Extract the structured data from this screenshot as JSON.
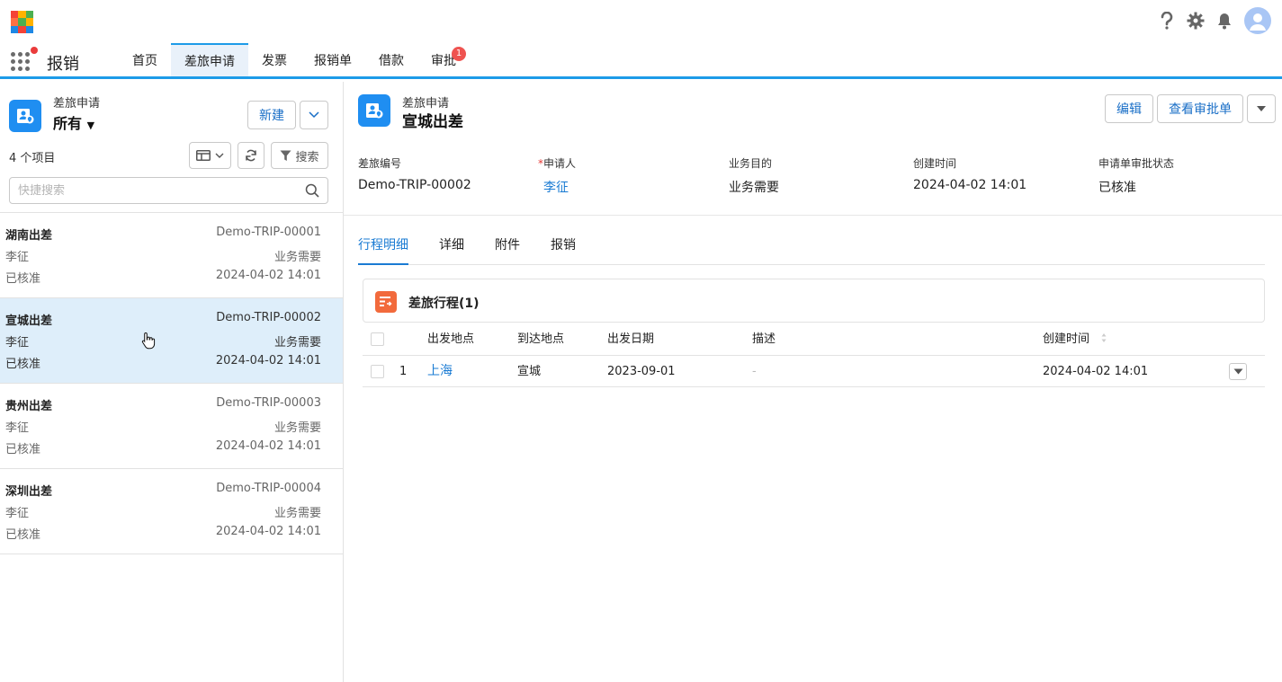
{
  "colors": {
    "accent": "#1d9be8",
    "link": "#1a7bd3",
    "badge": "#ef5350",
    "selected_row": "#deeefa",
    "object_icon": "#1f8ef1",
    "card_icon": "#f26a3c"
  },
  "app": {
    "name": "报销"
  },
  "nav": {
    "tabs": [
      {
        "label": "首页"
      },
      {
        "label": "差旅申请"
      },
      {
        "label": "发票"
      },
      {
        "label": "报销单"
      },
      {
        "label": "借款"
      },
      {
        "label": "审批",
        "badge": "1"
      }
    ]
  },
  "header_icons": [
    "help-icon",
    "gear-icon",
    "bell-icon",
    "user-avatar-icon"
  ],
  "list_panel": {
    "object_name": "差旅申请",
    "view_name": "所有",
    "new_label": "新建",
    "count_text": "4 个项目",
    "search_label": "搜索",
    "search_placeholder": "快捷搜索",
    "items": [
      {
        "title": "湖南出差",
        "code": "Demo-TRIP-00001",
        "person": "李征",
        "purpose": "业务需要",
        "status": "已核准",
        "time": "2024-04-02 14:01"
      },
      {
        "title": "宣城出差",
        "code": "Demo-TRIP-00002",
        "person": "李征",
        "purpose": "业务需要",
        "status": "已核准",
        "time": "2024-04-02 14:01"
      },
      {
        "title": "贵州出差",
        "code": "Demo-TRIP-00003",
        "person": "李征",
        "purpose": "业务需要",
        "status": "已核准",
        "time": "2024-04-02 14:01"
      },
      {
        "title": "深圳出差",
        "code": "Demo-TRIP-00004",
        "person": "李征",
        "purpose": "业务需要",
        "status": "已核准",
        "time": "2024-04-02 14:01"
      }
    ]
  },
  "record": {
    "object_name": "差旅申请",
    "title": "宣城出差",
    "edit_label": "编辑",
    "view_approval_label": "查看审批单",
    "fields": [
      {
        "label": "差旅编号",
        "value": "Demo-TRIP-00002"
      },
      {
        "label": "申请人",
        "value": "李征",
        "required_mark": "*"
      },
      {
        "label": "业务目的",
        "value": "业务需要"
      },
      {
        "label": "创建时间",
        "value": "2024-04-02 14:01"
      },
      {
        "label": "申请单审批状态",
        "value": "已核准"
      }
    ],
    "tabs": [
      {
        "label": "行程明细"
      },
      {
        "label": "详细"
      },
      {
        "label": "附件"
      },
      {
        "label": "报销"
      }
    ],
    "related": {
      "title": "差旅行程(1)",
      "columns": [
        "出发地点",
        "到达地点",
        "出发日期",
        "描述",
        "创建时间"
      ],
      "rows": [
        {
          "index": "1",
          "from": "上海",
          "to": "宣城",
          "date": "2023-09-01",
          "desc": "-",
          "created": "2024-04-02 14:01"
        }
      ]
    }
  }
}
